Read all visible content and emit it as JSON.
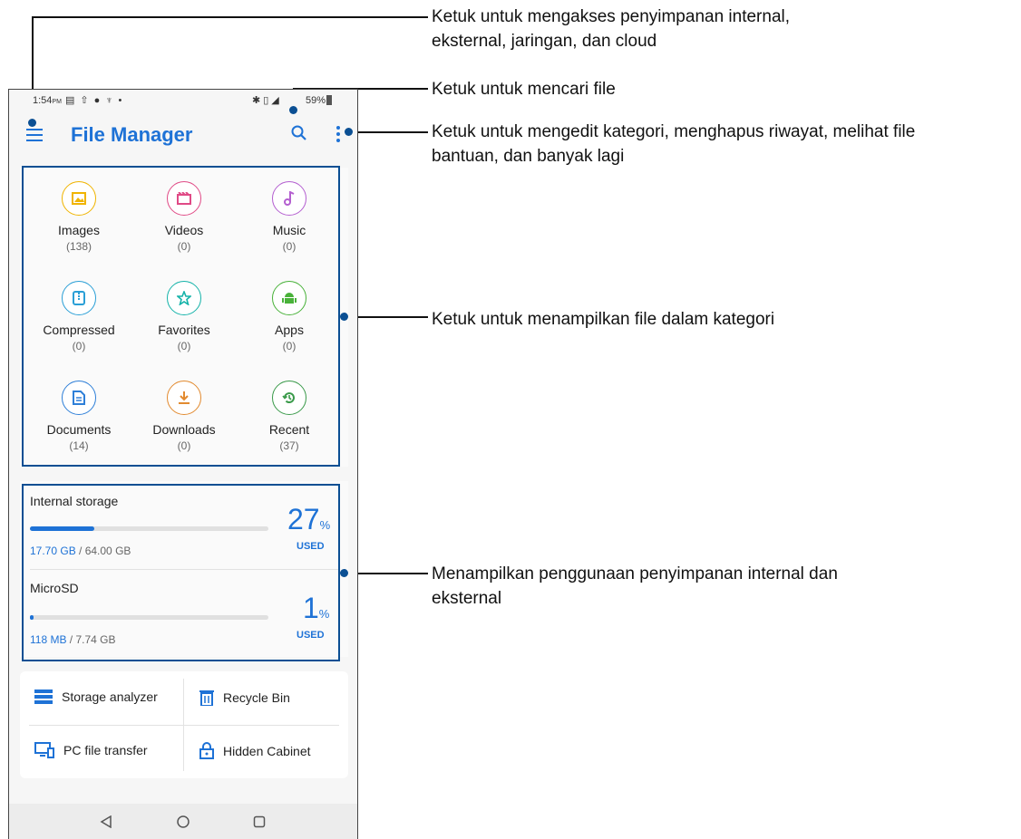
{
  "status_bar": {
    "time": "1:54",
    "ampm": "PM",
    "battery": "59%"
  },
  "app": {
    "title": "File Manager"
  },
  "categories": [
    {
      "label": "Images",
      "count": "(138)",
      "icon": "image-icon",
      "color": "#f0b400"
    },
    {
      "label": "Videos",
      "count": "(0)",
      "icon": "video-icon",
      "color": "#e04a86"
    },
    {
      "label": "Music",
      "count": "(0)",
      "icon": "music-icon",
      "color": "#b45fd0"
    },
    {
      "label": "Compressed",
      "count": "(0)",
      "icon": "archive-icon",
      "color": "#2a9fd6"
    },
    {
      "label": "Favorites",
      "count": "(0)",
      "icon": "star-icon",
      "color": "#15b3a9"
    },
    {
      "label": "Apps",
      "count": "(0)",
      "icon": "android-icon",
      "color": "#49b23a"
    },
    {
      "label": "Documents",
      "count": "(14)",
      "icon": "document-icon",
      "color": "#2e7fd8"
    },
    {
      "label": "Downloads",
      "count": "(0)",
      "icon": "download-icon",
      "color": "#e28a2f"
    },
    {
      "label": "Recent",
      "count": "(37)",
      "icon": "history-icon",
      "color": "#3a9a4a"
    }
  ],
  "storage": [
    {
      "name": "Internal storage",
      "percent": "27",
      "percent_unit": "%",
      "used_label": "USED",
      "used": "17.70 GB",
      "total": " / 64.00 GB",
      "fill": 0.27
    },
    {
      "name": "MicroSD",
      "percent": "1",
      "percent_unit": "%",
      "used_label": "USED",
      "used": "118 MB",
      "total": " / 7.74 GB",
      "fill": 0.01
    }
  ],
  "tools": [
    {
      "label": "Storage analyzer",
      "icon": "storage-analyzer-icon"
    },
    {
      "label": "Recycle Bin",
      "icon": "trash-icon"
    },
    {
      "label": "PC file transfer",
      "icon": "pc-transfer-icon"
    },
    {
      "label": "Hidden Cabinet",
      "icon": "lock-icon"
    }
  ],
  "callouts": {
    "menu": "Ketuk untuk mengakses penyimpanan internal,\neksternal, jaringan, dan cloud",
    "search": "Ketuk untuk mencari file",
    "more": "Ketuk untuk mengedit kategori, menghapus riwayat, melihat file\nbantuan, dan banyak lagi",
    "categories": "Ketuk untuk menampilkan file dalam kategori",
    "storage": "Menampilkan penggunaan penyimpanan internal dan\neksternal"
  },
  "colors": {
    "accent": "#1e72d6",
    "highlight": "#0b4f93"
  }
}
